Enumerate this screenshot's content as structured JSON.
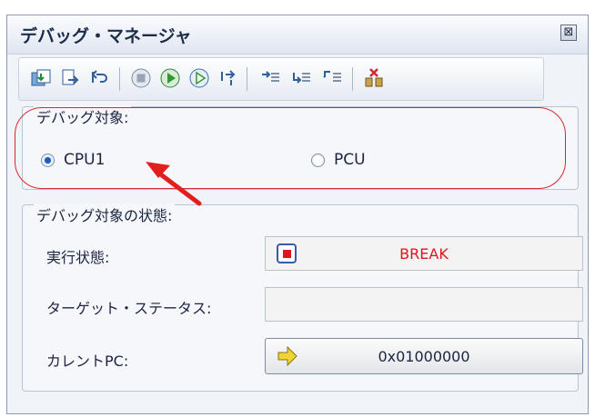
{
  "panel": {
    "title": "デバッグ・マネージャ",
    "close_glyph": "⊠"
  },
  "toolbar": {
    "buttons": [
      "download-icon",
      "reload-icon",
      "reset-icon",
      "stop-icon",
      "go-icon",
      "run-icon",
      "step-return-icon",
      "step-in-icon",
      "step-over-icon",
      "return-out-icon",
      "disconnect-icon"
    ]
  },
  "target": {
    "group_label": "デバッグ対象:",
    "options": [
      {
        "label": "CPU1",
        "selected": true
      },
      {
        "label": "PCU",
        "selected": false
      }
    ]
  },
  "status": {
    "group_label": "デバッグ対象の状態:",
    "exec_label": "実行状態:",
    "exec_value": "BREAK",
    "target_status_label": "ターゲット・ステータス:",
    "target_status_value": "",
    "pc_label": "カレントPC:",
    "pc_value": "0x01000000"
  },
  "colors": {
    "accent": "#1e5db7",
    "break_text": "#e0141e",
    "highlight": "#d8282e"
  }
}
